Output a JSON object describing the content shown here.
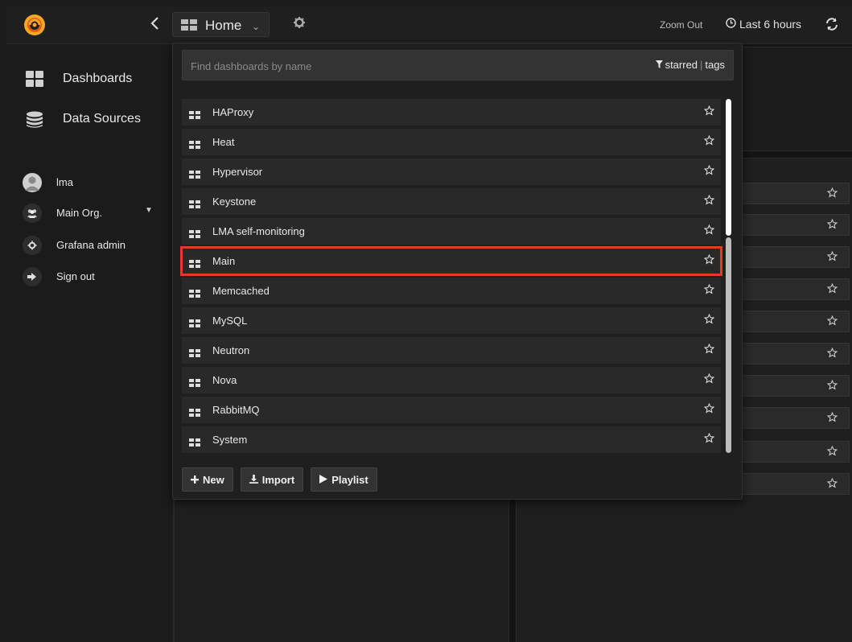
{
  "topbar": {
    "home_label": "Home",
    "zoom_out_label": "Zoom Out",
    "time_range_label": "Last 6 hours"
  },
  "sidebar": {
    "nav": [
      {
        "label": "Dashboards",
        "icon": "dashboards-grid-icon"
      },
      {
        "label": "Data Sources",
        "icon": "database-icon"
      }
    ],
    "user": {
      "name": "lma",
      "org": "Main Org.",
      "admin_label": "Grafana admin",
      "signout_label": "Sign out"
    }
  },
  "dropdown": {
    "search_placeholder": "Find dashboards by name",
    "filter_starred": "starred",
    "filter_sep": "|",
    "filter_tags": "tags",
    "items": [
      {
        "name": "HAProxy"
      },
      {
        "name": "Heat"
      },
      {
        "name": "Hypervisor"
      },
      {
        "name": "Keystone"
      },
      {
        "name": "LMA self-monitoring"
      },
      {
        "name": "Main",
        "highlighted": true
      },
      {
        "name": "Memcached"
      },
      {
        "name": "MySQL"
      },
      {
        "name": "Neutron"
      },
      {
        "name": "Nova"
      },
      {
        "name": "RabbitMQ"
      },
      {
        "name": "System"
      }
    ],
    "buttons": {
      "new_label": "New",
      "import_label": "Import",
      "playlist_label": "Playlist"
    }
  },
  "colors": {
    "highlight": "#e8372b",
    "logo_orange": "#f5a623"
  }
}
